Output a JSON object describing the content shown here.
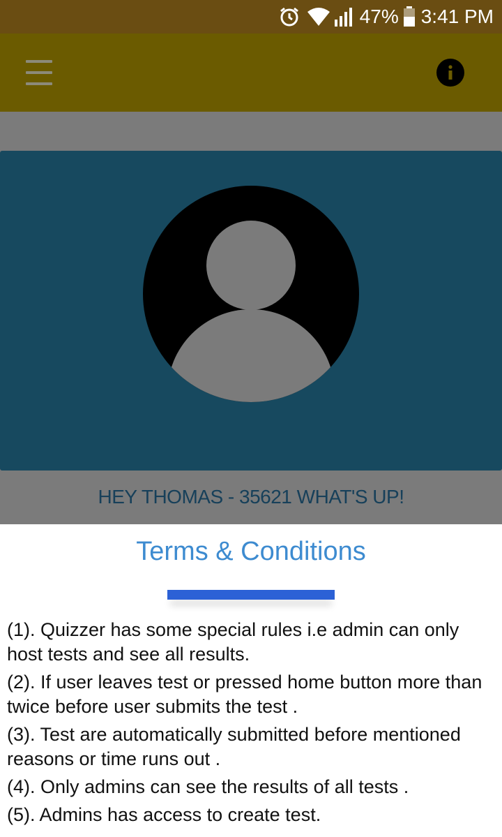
{
  "status_bar": {
    "battery_percent": "47%",
    "time": "3:41 PM",
    "icons": [
      "alarm-icon",
      "wifi-icon",
      "signal-icon",
      "battery-icon"
    ]
  },
  "app_bar": {
    "menu_icon": "hamburger-menu-icon",
    "info_icon": "info-icon",
    "info_glyph": "i",
    "color": "#6b5b00"
  },
  "profile": {
    "avatar_icon": "default-user-avatar",
    "greeting": "HEY THOMAS - 35621 WHAT'S UP!",
    "card_color": "#17495f"
  },
  "dialog": {
    "title": "Terms & Conditions",
    "rules": [
      "(1). Quizzer has some special rules i.e admin can only host tests and see all results.",
      "(2). If user leaves test or pressed home button more than twice before user submits the test .",
      "(3). Test are automatically submitted before mentioned reasons or time runs out .",
      "(4). Only admins can see the results of all tests .",
      "(5). Admins has access to create test."
    ],
    "accent_color": "#2c61d6"
  }
}
